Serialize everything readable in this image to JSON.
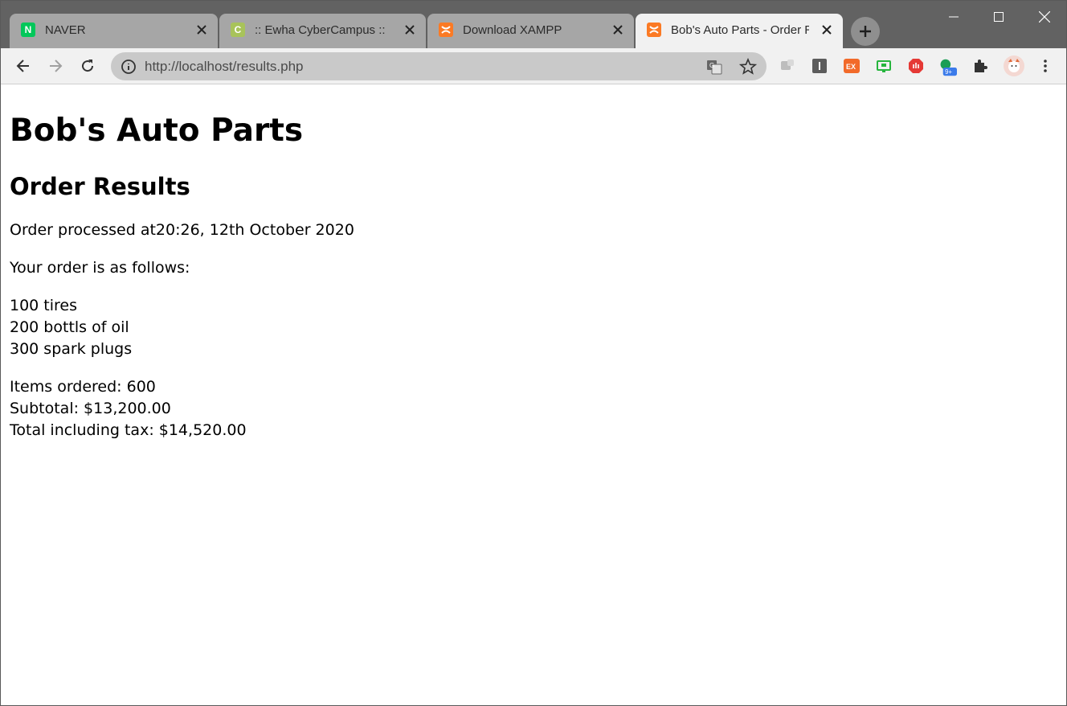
{
  "browser": {
    "tabs": [
      {
        "title": "NAVER",
        "favicon": "naver-icon",
        "favicon_color": "#03c75a",
        "favicon_letter": "N",
        "active": false
      },
      {
        "title": ":: Ewha CyberCampus ::",
        "favicon": "cybercampus-icon",
        "favicon_color": "#a8c35a",
        "favicon_letter": "C",
        "active": false
      },
      {
        "title": "Download XAMPP",
        "favicon": "xampp-icon",
        "favicon_color": "#fb7a24",
        "favicon_letter": "",
        "active": false
      },
      {
        "title": "Bob's Auto Parts - Order Results",
        "favicon": "xampp-icon",
        "favicon_color": "#fb7a24",
        "favicon_letter": "",
        "active": true
      }
    ],
    "address": "http://localhost/results.php",
    "extension_badge": "9+"
  },
  "page": {
    "title": "Bob's Auto Parts",
    "subtitle": "Order Results",
    "processed": "Order processed at20:26, 12th October 2020",
    "intro": "Your order is as follows:",
    "items": [
      "100 tires",
      "200 bottls of oil",
      "300 spark plugs"
    ],
    "summary": [
      "Items ordered: 600",
      "Subtotal: $13,200.00",
      "Total including tax: $14,520.00"
    ]
  }
}
